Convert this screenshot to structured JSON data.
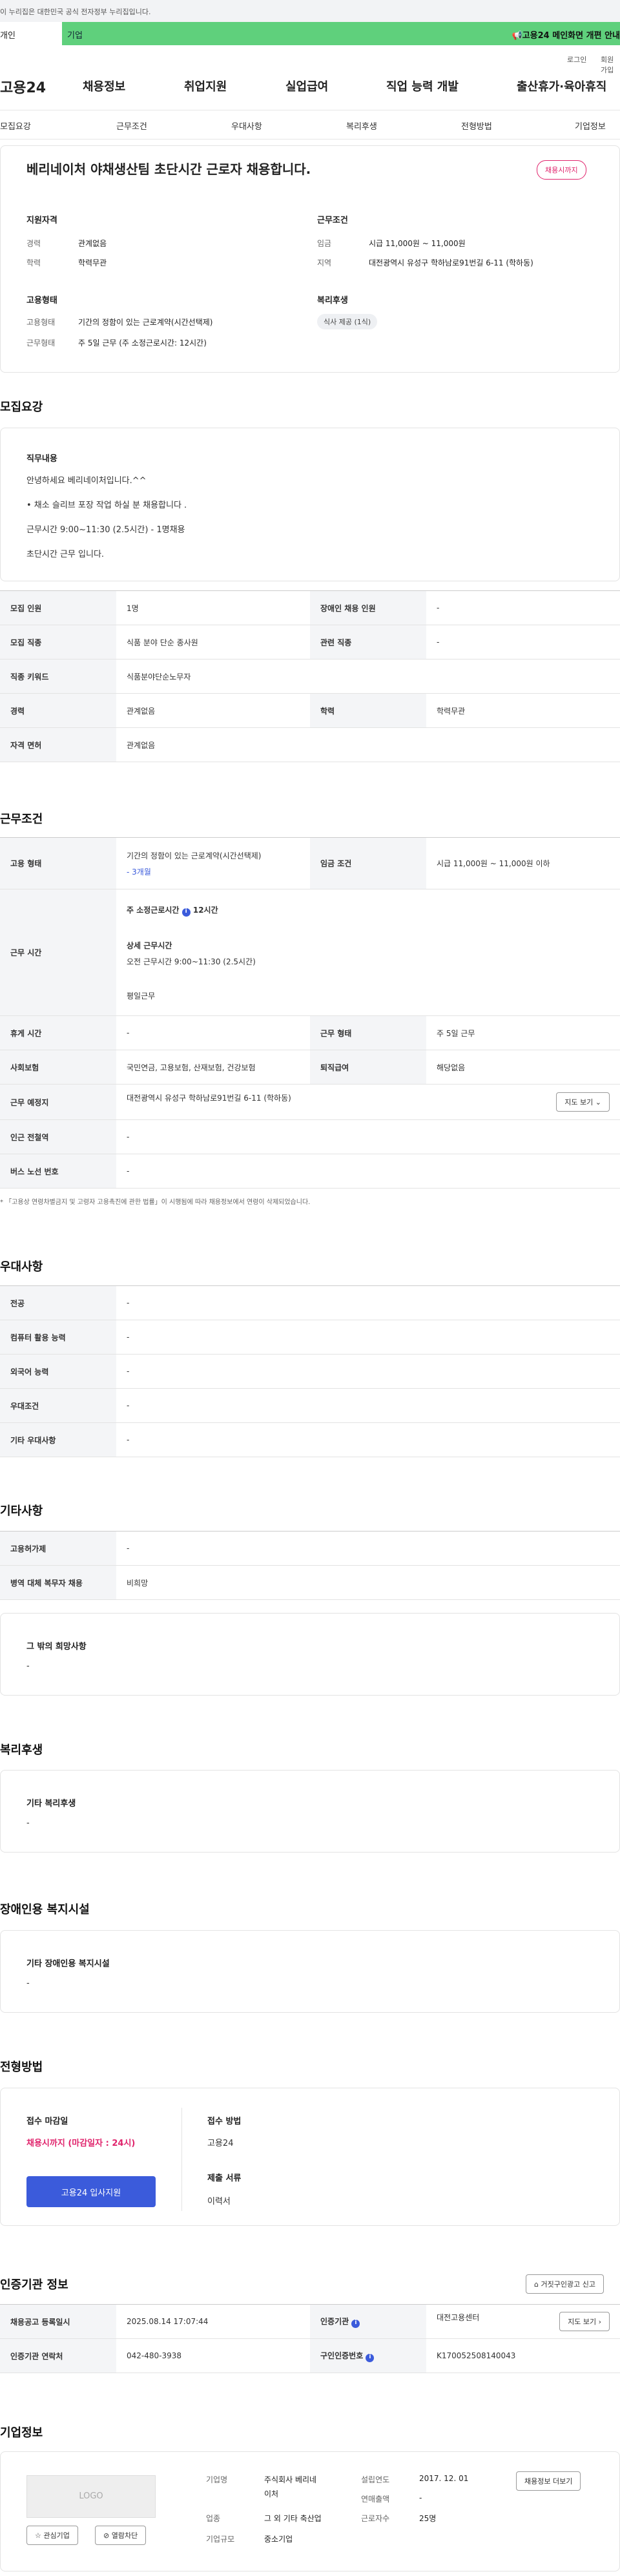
{
  "top": {
    "gov_banner": "이 누리집은 대한민국 공식 전자정부 누리집입니다.",
    "tab_personal": "개인",
    "tab_company": "기업",
    "notice": "고용24 메인화면 개편 안내",
    "login": "로그인",
    "join": "회원가입"
  },
  "gnb": {
    "logo": "고용24",
    "menu": [
      "채용정보",
      "취업지원",
      "실업급여",
      "직업 능력 개발",
      "출산휴가·육아휴직"
    ]
  },
  "lnb": [
    "모집요강",
    "근무조건",
    "우대사항",
    "복리후생",
    "전형방법",
    "기업정보"
  ],
  "summary": {
    "title": "베리네이처 야채생산팀 초단시간 근로자 채용합니다.",
    "badge": "채용시까지",
    "qual_h": "지원자격",
    "qual": [
      [
        "경력",
        "관계없음"
      ],
      [
        "학력",
        "학력무관"
      ]
    ],
    "cond_h": "근무조건",
    "cond": [
      [
        "임금",
        "시급 11,000원 ~ 11,000원"
      ],
      [
        "지역",
        "대전광역시 유성구 학하남로91번길 6-11 (학하동)"
      ]
    ],
    "emp_h": "고용형태",
    "emp": [
      [
        "고용형태",
        "기간의 정함이 있는 근로계약(시간선택제)"
      ],
      [
        "근무형태",
        "주 5일 근무 (주 소정근로시간: 12시간)"
      ]
    ],
    "welfare_h": "복리후생",
    "welfare_chip": "식사 제공 (1식)"
  },
  "recruit": {
    "title": "모집요강",
    "job_h": "직무내용",
    "job_lines": [
      "안녕하세요 베리네이처입니다.^^",
      "• 채소 슬리브 포장 작업 하실 분 채용합니다 .",
      "근무시간 9:00~11:30 (2.5시간) - 1명채용",
      "초단시간 근무 입니다."
    ],
    "rows": [
      [
        "모집 인원",
        "1명",
        "장애인 채용 인원",
        "-"
      ],
      [
        "모집 직종",
        "식품 분야 단순 종사원",
        "관련 직종",
        "-"
      ],
      [
        "직종 키워드",
        "식품분야단순노무자"
      ],
      [
        "경력",
        "관계없음",
        "학력",
        "학력무관"
      ],
      [
        "자격 면허",
        "관계없음"
      ]
    ]
  },
  "work": {
    "title": "근무조건",
    "emp_type_h": "고용 형태",
    "emp_type_l1": "기간의 정함이 있는 근로계약(시간선택제)",
    "emp_type_l2": "- 3개월",
    "wage_h": "임금 조건",
    "wage_v": "시급 11,000원 ~ 11,000원 이하",
    "hours_h": "근무 시간",
    "hours_weekly": "주 소정근로시간",
    "hours_weekly_v": "12시간",
    "hours_detail_h": "상세 근무시간",
    "hours_detail_v": "오전 근무시간 9:00~11:30 (2.5시간)",
    "hours_weekday": "평일근무",
    "rest_h": "휴게 시간",
    "rest_v": "-",
    "shift_h": "근무 형태",
    "shift_v": "주 5일 근무",
    "ins_h": "사회보험",
    "ins_v": "국민연금, 고용보험, 산재보험, 건강보험",
    "sev_h": "퇴직급여",
    "sev_v": "해당없음",
    "place_h": "근무 예정지",
    "place_v": "대전광역시 유성구 학하남로91번길 6-11 (학하동)",
    "map_btn": "지도 보기",
    "subway_h": "인근 전철역",
    "subway_v": "-",
    "bus_h": "버스 노선 번호",
    "bus_v": "-",
    "footnote": "* 「고용상 연령차별금지 및 고령자 고용촉진에 관한 법률」이 시행됨에 따라 채용정보에서 연령이 삭제되었습니다."
  },
  "pref": {
    "title": "우대사항",
    "rows": [
      [
        "전공",
        "-"
      ],
      [
        "컴퓨터 활용 능력",
        "-"
      ],
      [
        "외국어 능력",
        "-"
      ],
      [
        "우대조건",
        "-"
      ],
      [
        "기타 우대사항",
        "-"
      ]
    ]
  },
  "other": {
    "title": "기타사항",
    "rows": [
      [
        "고용허가제",
        "-"
      ],
      [
        "병역 대체 복무자 채용",
        "비희망"
      ]
    ],
    "box_h": "그 밖의 희망사항",
    "box_v": "-"
  },
  "welfare": {
    "title": "복리후생",
    "box_h": "기타 복리후생",
    "box_v": "-"
  },
  "disabled": {
    "title": "장애인용 복지시설",
    "box_h": "기타 장애인용 복지시설",
    "box_v": "-"
  },
  "selection": {
    "title": "전형방법",
    "deadline_h": "접수 마감일",
    "deadline_v": "채용시까지 (마감일자 : 24시)",
    "apply_btn": "고용24 입사지원",
    "method_h": "접수 방법",
    "method_v": "고용24",
    "docs_h": "제출 서류",
    "docs_v": "이력서"
  },
  "agency": {
    "title": "인증기관 정보",
    "report_btn": "거짓구인광고 신고",
    "reg_h": "채용공고 등록일시",
    "reg_v": "2025.08.14 17:07:44",
    "org_h": "인증기관",
    "org_v": "대전고용센터",
    "map_btn": "지도 보기",
    "tel_h": "인증기관 연락처",
    "tel_v": "042-480-3938",
    "auth_h": "구인인증번호",
    "auth_v": "K170052508140043"
  },
  "company": {
    "title": "기업정보",
    "logo": "LOGO",
    "fav_btn": "관심기업",
    "block_btn": "열람차단",
    "name_h": "기업명",
    "name_v1": "주식회사 베리네",
    "name_v2": "이처",
    "biz_h": "업종",
    "biz_v": "그 외 기타 축산업",
    "size_h": "기업규모",
    "size_v": "중소기업",
    "est_h": "설립연도",
    "est_v": "2017. 12. 01",
    "sales_h": "연매출액",
    "sales_v": "-",
    "emp_h": "근로자수",
    "emp_v": "25명",
    "more_btn": "채용정보 더보기"
  }
}
